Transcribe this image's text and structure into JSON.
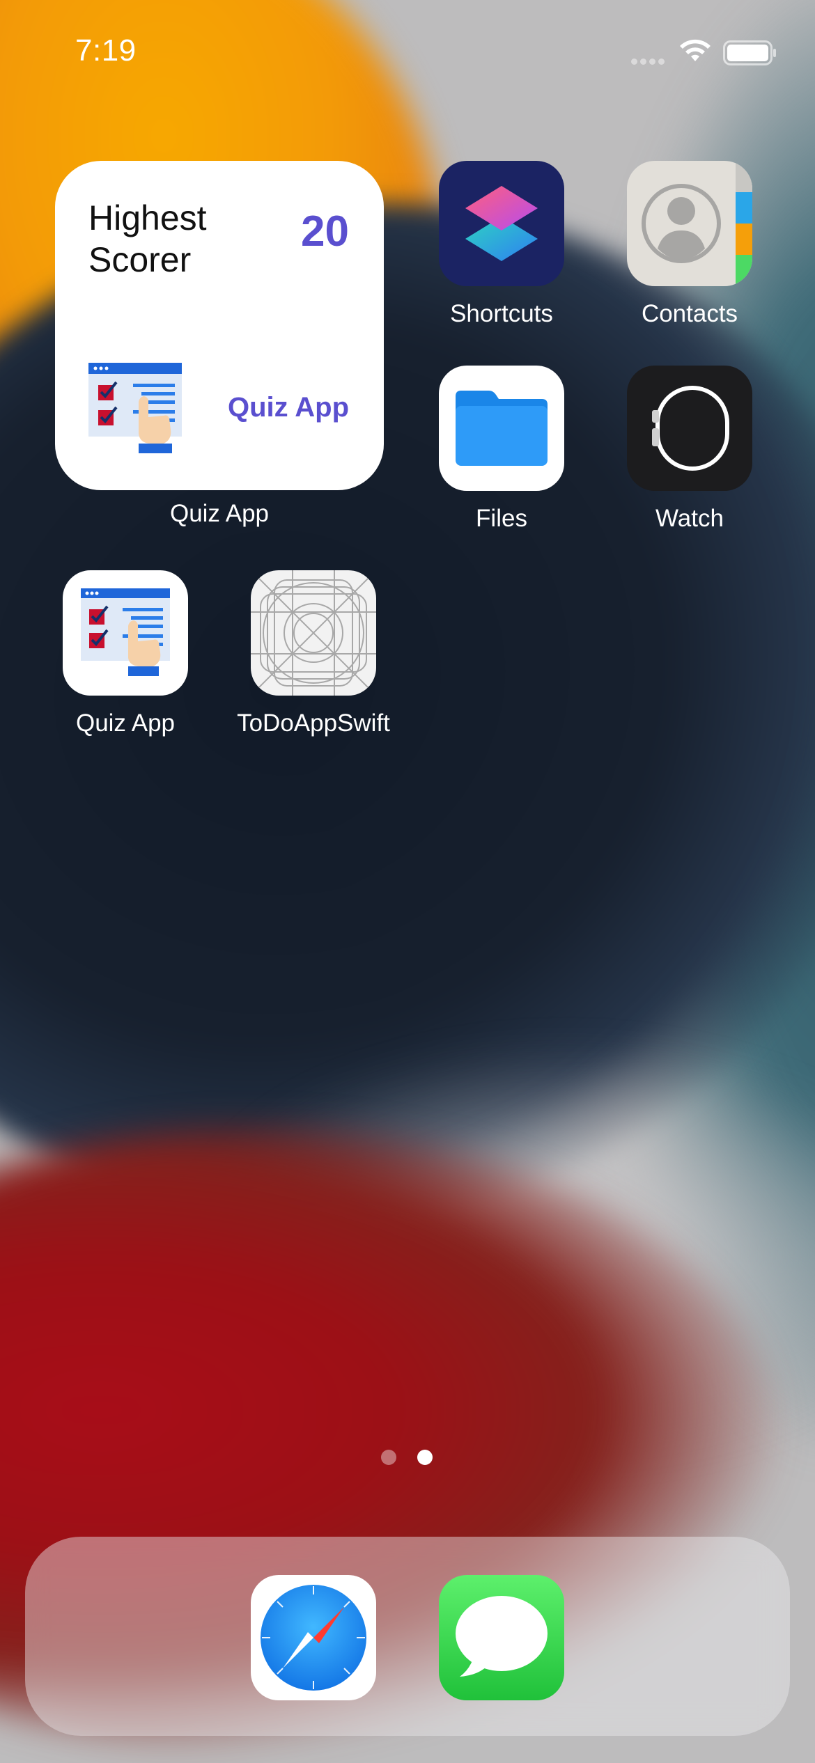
{
  "status_bar": {
    "time": "7:19"
  },
  "widget": {
    "title": "Highest Scorer",
    "score": "20",
    "app_name": "Quiz App",
    "label": "Quiz App",
    "accent": "#5a4fcf"
  },
  "apps": [
    {
      "label": "Shortcuts",
      "icon": "shortcuts-icon"
    },
    {
      "label": "Contacts",
      "icon": "contacts-icon"
    },
    {
      "label": "Files",
      "icon": "folder-icon"
    },
    {
      "label": "Watch",
      "icon": "watch-icon"
    },
    {
      "label": "Quiz App",
      "icon": "quiz-checklist-icon"
    },
    {
      "label": "ToDoAppSwift",
      "icon": "placeholder-grid-icon"
    }
  ],
  "page_indicator": {
    "pages": 2,
    "current": 2
  },
  "dock": [
    {
      "name": "Safari",
      "icon": "compass-icon"
    },
    {
      "name": "Messages",
      "icon": "speech-bubble-icon"
    }
  ]
}
